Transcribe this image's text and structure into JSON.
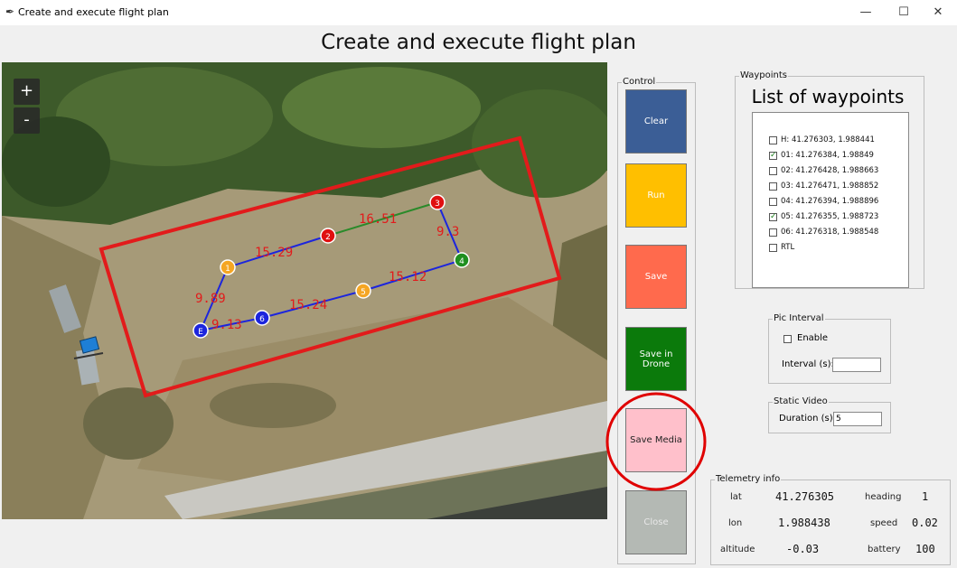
{
  "window": {
    "title": "Create and execute flight plan",
    "minimize_glyph": "—",
    "maximize_glyph": "☐",
    "close_glyph": "✕"
  },
  "header": {
    "title": "Create and execute flight plan"
  },
  "map": {
    "zoom_in": "+",
    "zoom_out": "-",
    "segment_labels": [
      "15.29",
      "16.51",
      "9.3",
      "15.12",
      "15.24",
      "9.13",
      "9.89"
    ],
    "markers": [
      "1",
      "2",
      "3",
      "4",
      "5",
      "6",
      "E"
    ]
  },
  "control": {
    "title": "Control",
    "clear": "Clear",
    "run": "Run",
    "save": "Save",
    "save_in_drone": "Save in Drone",
    "save_media": "Save Media",
    "close": "Close"
  },
  "waypoints": {
    "group_title": "Waypoints",
    "heading": "List of waypoints",
    "items": [
      {
        "label": "H:  41.276303, 1.988441",
        "checked": false
      },
      {
        "label": "01:  41.276384, 1.98849",
        "checked": true
      },
      {
        "label": "02:  41.276428, 1.988663",
        "checked": false
      },
      {
        "label": "03:  41.276471, 1.988852",
        "checked": false
      },
      {
        "label": "04:  41.276394, 1.988896",
        "checked": false
      },
      {
        "label": "05:  41.276355, 1.988723",
        "checked": true
      },
      {
        "label": "06:  41.276318, 1.988548",
        "checked": false
      },
      {
        "label": "RTL",
        "checked": false
      }
    ]
  },
  "pic_interval": {
    "title": "Pic Interval",
    "enable_label": "Enable",
    "interval_label": "Interval (s):",
    "interval_value": ""
  },
  "static_video": {
    "title": "Static Video",
    "duration_label": "Duration (s):",
    "duration_value": "5"
  },
  "telemetry": {
    "title": "Telemetry info",
    "lat_label": "lat",
    "lat_value": "41.276305",
    "lon_label": "lon",
    "lon_value": "1.988438",
    "altitude_label": "altitude",
    "altitude_value": "-0.03",
    "heading_label": "heading",
    "heading_value": "1",
    "speed_label": "speed",
    "speed_value": "0.02",
    "battery_label": "battery",
    "battery_value": "100"
  },
  "colors": {
    "clear": "#3b5e96",
    "run": "#ffbf00",
    "save": "#ff6a4d",
    "save_in_drone": "#0b7a0b",
    "save_media": "#ffc0cb",
    "close": "#b4b9b4",
    "fence": "#e21b1b",
    "path_blue": "#1c25dd",
    "path_green": "#2a8a2a",
    "highlight_circle": "#e00000"
  }
}
